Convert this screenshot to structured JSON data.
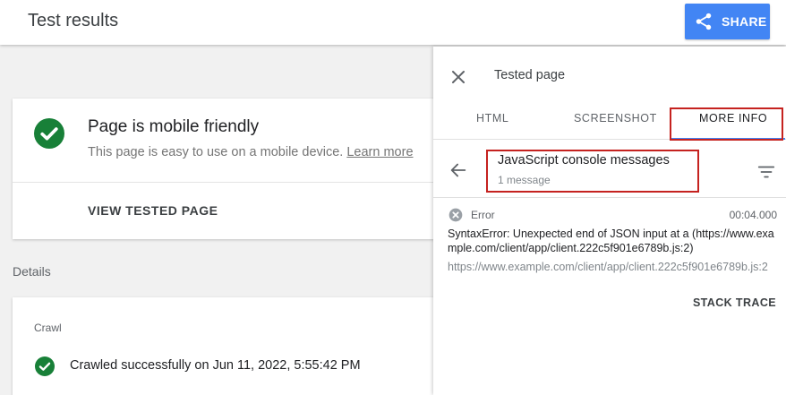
{
  "header": {
    "title": "Test results",
    "share_label": "SHARE"
  },
  "result_card": {
    "title": "Page is mobile friendly",
    "subtitle": "This page is easy to use on a mobile device.",
    "learn_more": "Learn more",
    "view_button": "VIEW TESTED PAGE"
  },
  "details": {
    "label": "Details"
  },
  "crawl_card": {
    "label": "Crawl",
    "status": "Crawled successfully on Jun 11, 2022, 5:55:42 PM"
  },
  "panel": {
    "title": "Tested page",
    "tabs": [
      {
        "label": "HTML"
      },
      {
        "label": "SCREENSHOT"
      },
      {
        "label": "MORE INFO"
      }
    ],
    "active_tab": "MORE INFO",
    "console": {
      "title": "JavaScript console messages",
      "count": "1 message",
      "messages": [
        {
          "level": "Error",
          "time": "00:04.000",
          "text": "SyntaxError: Unexpected end of JSON input at a (https://www.example.com/client/app/client.222c5f901e6789b.js:2)",
          "source": "https://www.example.com/client/app/client.222c5f901e6789b.js:2",
          "stack_label": "STACK TRACE"
        }
      ]
    }
  },
  "colors": {
    "accent": "#4285f4",
    "success": "#188038",
    "highlight": "#c5221f"
  },
  "icons": [
    "share-icon",
    "check-circle-icon",
    "close-icon",
    "back-arrow-icon",
    "filter-icon",
    "error-icon"
  ]
}
